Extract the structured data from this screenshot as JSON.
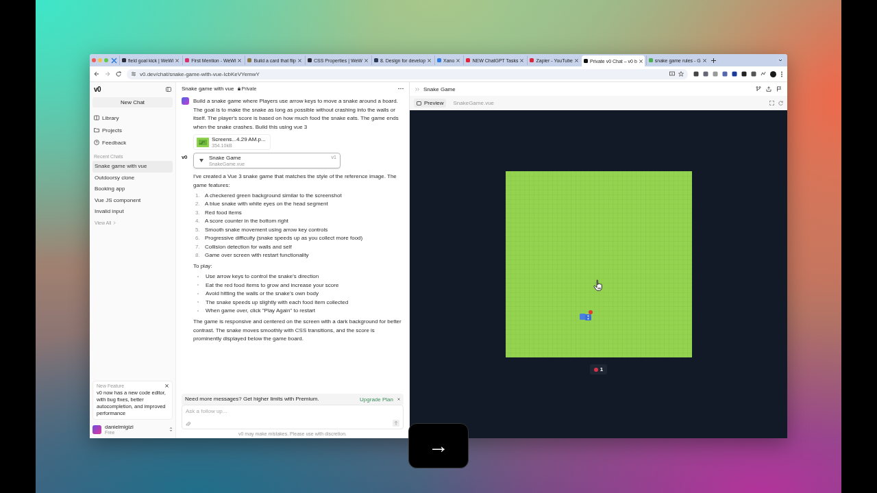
{
  "browser": {
    "tabs": [
      {
        "title": "field goal kick | WeWi",
        "selected": false,
        "color": "#2d2d3a"
      },
      {
        "title": "First Mention - WeWi",
        "selected": false,
        "color": "#d6336c"
      },
      {
        "title": "Build a card that flip",
        "selected": false,
        "color": "#8a7a4a"
      },
      {
        "title": "CSS Properties | WeW",
        "selected": false,
        "color": "#2d2d3a"
      },
      {
        "title": "8. Design for develop",
        "selected": false,
        "color": "#2d3a5a"
      },
      {
        "title": "Xano",
        "selected": false,
        "color": "#2f7de1"
      },
      {
        "title": "NEW ChatGPT Tasks",
        "selected": false,
        "color": "#e0243c"
      },
      {
        "title": "Zapier - YouTube",
        "selected": false,
        "color": "#e0243c"
      },
      {
        "title": "Private v0 Chat – v0 b",
        "selected": true,
        "color": "#111111"
      },
      {
        "title": "snake game rules - G",
        "selected": false,
        "color": "#4caf50"
      }
    ],
    "url": "v0.dev/chat/snake-game-with-vue-IcbKeVYemwY"
  },
  "sidebar": {
    "logo": "v0",
    "new_chat": "New Chat",
    "nav": [
      {
        "label": "Library",
        "kind": "book"
      },
      {
        "label": "Projects",
        "kind": "folder"
      },
      {
        "label": "Feedback",
        "kind": "help"
      }
    ],
    "recent_heading": "Recent Chats",
    "recent": [
      {
        "label": "Snake game with vue",
        "selected": true
      },
      {
        "label": "Outdoorsy clone",
        "selected": false
      },
      {
        "label": "Booking app",
        "selected": false
      },
      {
        "label": "Vue JS component",
        "selected": false
      },
      {
        "label": "Invalid input",
        "selected": false
      }
    ],
    "view_all": "View All",
    "notice": {
      "heading": "New Feature",
      "text": "v0 now has a new code editor, with bug fixes, better autocompletion, and improved performance"
    },
    "user": {
      "name": "danielmigizi",
      "plan": "Free"
    }
  },
  "chat": {
    "title": "Snake game with vue",
    "visibility": "Private",
    "user_message": "Build a snake game where Players use arrow keys to move a snake around a board. The goal is to make the snake as long as possible without crashing into the walls or itself. The player's score is based on how much food the snake eats. The game ends when the snake crashes. Build this using vue 3",
    "attachment": {
      "name": "Screens...4.29 AM.p...",
      "size": "354.10kB"
    },
    "assistant_logo": "v0",
    "artifact": {
      "title": "Snake Game",
      "file": "SnakeGame.vue",
      "version": "v1"
    },
    "intro": "I've created a Vue 3 snake game that matches the style of the reference image. The game features:",
    "features": [
      {
        "number": "1.",
        "text": "A checkered green background similar to the screenshot"
      },
      {
        "number": "2.",
        "text": "A blue snake with white eyes on the head segment"
      },
      {
        "number": "3.",
        "text": "Red food items"
      },
      {
        "number": "4.",
        "text": "A score counter in the bottom right"
      },
      {
        "number": "5.",
        "text": "Smooth snake movement using arrow key controls"
      },
      {
        "number": "6.",
        "text": "Progressive difficulty (snake speeds up as you collect more food)"
      },
      {
        "number": "7.",
        "text": "Collision detection for walls and self"
      },
      {
        "number": "8.",
        "text": "Game over screen with restart functionality"
      }
    ],
    "play_heading": "To play:",
    "tips": [
      "Use arrow keys to control the snake's direction",
      "Eat the red food items to grow and increase your score",
      "Avoid hitting the walls or the snake's own body",
      "The snake speeds up slightly with each food item collected",
      "When game over, click \"Play Again\" to restart"
    ],
    "closing": "The game is responsive and centered on the screen with a dark background for better contrast. The snake moves smoothly with CSS transitions, and the score is prominently displayed below the game board.",
    "banner": {
      "text": "Need more messages? Get higher limits with Premium.",
      "action": "Upgrade Plan"
    },
    "input": {
      "placeholder": "Ask a follow up..."
    },
    "disclaimer": "v0 may make mistakes. Please use with discretion."
  },
  "preview": {
    "title": "Snake Game",
    "tabs": [
      {
        "label": "Preview",
        "selected": true
      },
      {
        "label": "SnakeGame.vue",
        "selected": false
      }
    ],
    "score": "1"
  },
  "key_overlay": "→"
}
